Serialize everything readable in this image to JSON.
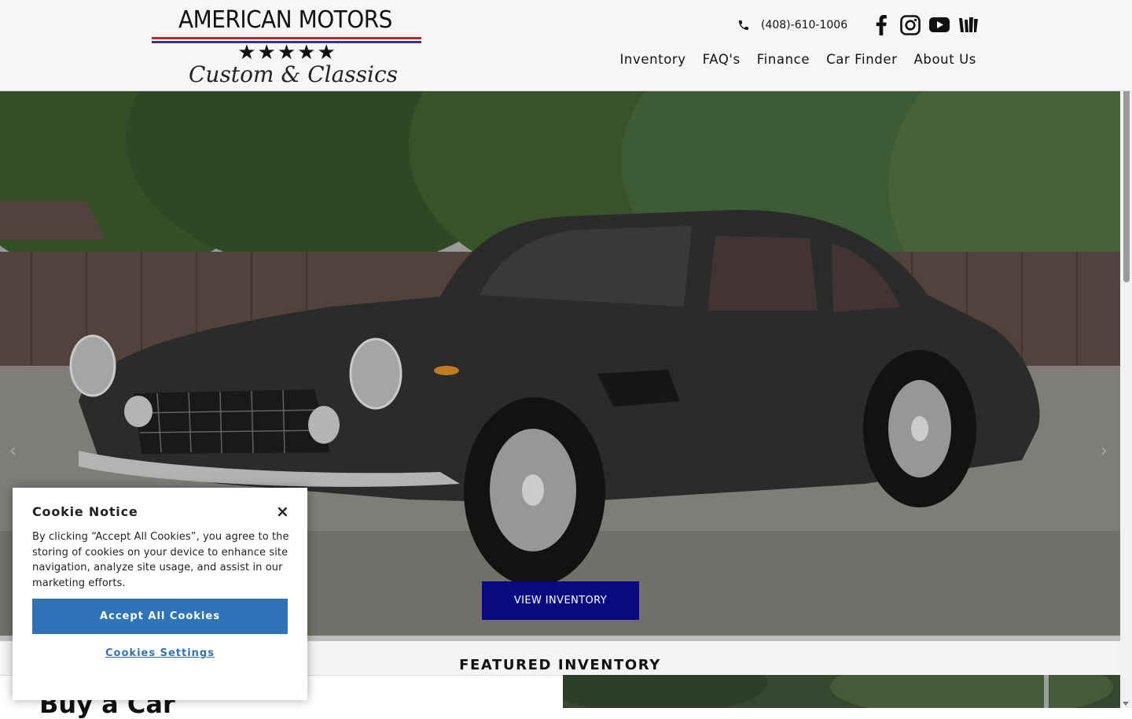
{
  "brand": {
    "name": "AMERICAN MOTORS",
    "stars": "★★★★★",
    "tagline": "Custom & Classics",
    "colors": {
      "stripe_red": "#c8232c",
      "stripe_blue": "#2b3a8f"
    }
  },
  "header": {
    "phone": "(408)-610-1006",
    "phone_icon": "phone-icon",
    "social": [
      "facebook-icon",
      "instagram-icon",
      "youtube-icon",
      "dealer-rater-icon"
    ],
    "nav": [
      {
        "label": "Inventory"
      },
      {
        "label": "FAQ's"
      },
      {
        "label": "Finance"
      },
      {
        "label": "Car Finder"
      },
      {
        "label": "About Us"
      }
    ]
  },
  "hero": {
    "cta_label": "VIEW INVENTORY",
    "cta_color": "#0a0a80",
    "prev_arrow": "‹",
    "next_arrow": "›"
  },
  "featured": {
    "title": "FEATURED INVENTORY",
    "buy_heading": "Buy a Car"
  },
  "cookie": {
    "title": "Cookie Notice",
    "close_glyph": "×",
    "body": "By clicking “Accept All Cookies”, you agree to the storing of cookies on your device to enhance site navigation, analyze site usage, and assist in our marketing efforts.",
    "accept_label": "Accept All Cookies",
    "settings_label": "Cookies Settings",
    "accent": "#2f73b8"
  }
}
